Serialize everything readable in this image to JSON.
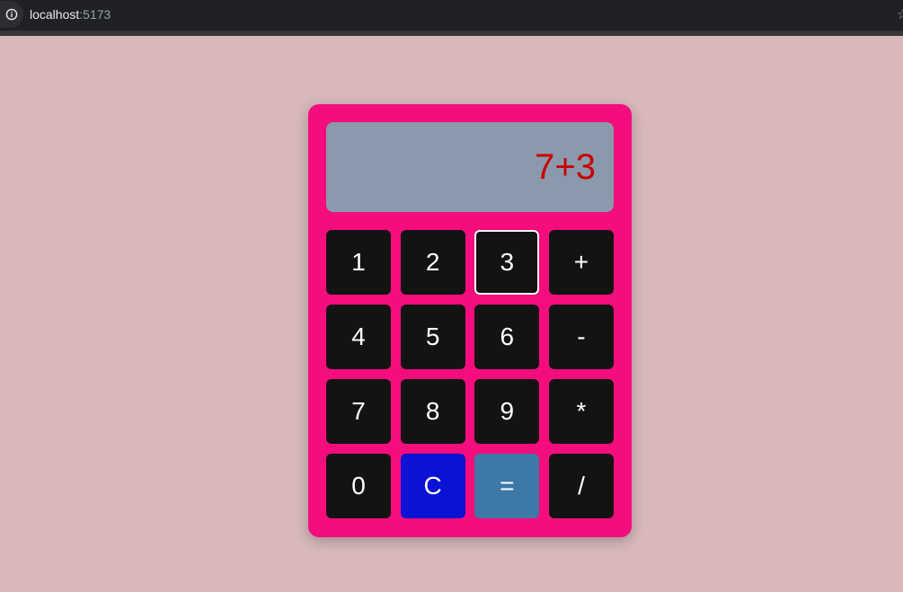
{
  "browser": {
    "url_host": "localhost",
    "url_port": ":5173",
    "info_icon": "info-icon",
    "bookmark_icon": "star-icon"
  },
  "calculator": {
    "display_value": "7+3",
    "colors": {
      "page_background": "#d8b8ba",
      "body": "#f50d7e",
      "display_background": "#8a9aac",
      "display_text": "#c80000",
      "key": "#131313",
      "clear_key": "#0a12d4",
      "equals_key": "#3e78a6"
    },
    "keys": [
      "1",
      "2",
      "3",
      "+",
      "4",
      "5",
      "6",
      "-",
      "7",
      "8",
      "9",
      "*",
      "0",
      "C",
      "=",
      "/"
    ],
    "focused_key": "3"
  }
}
